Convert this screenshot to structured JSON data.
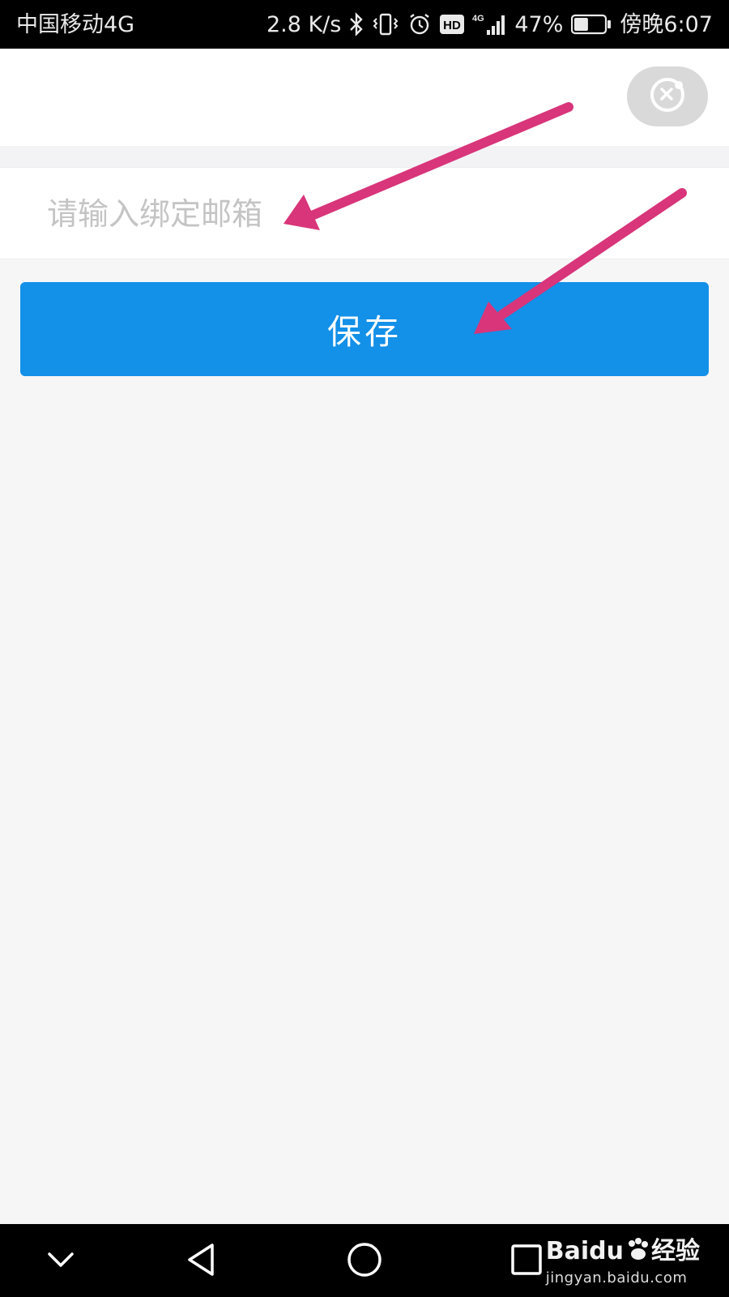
{
  "status_bar": {
    "carrier": "中国移动4G",
    "net_speed": "2.8 K/s",
    "network_label": "4G",
    "hd_label": "HD",
    "battery": "47%",
    "battery_level": 0.47,
    "time": "傍晚6:07",
    "icons": [
      "bluetooth-icon",
      "vibrate-icon",
      "alarm-icon",
      "hd-icon",
      "signal-icon",
      "battery-icon"
    ]
  },
  "top_bar": {
    "capsule_icon": "close-circle-icon"
  },
  "form": {
    "email_placeholder": "请输入绑定邮箱",
    "email_value": "",
    "save_label": "保存"
  },
  "annotations": {
    "arrow_color": "#d8357a"
  },
  "nav_bar": {
    "icons": [
      "chevron-down-icon",
      "back-triangle-icon",
      "home-circle-icon",
      "recents-square-icon"
    ]
  },
  "watermark": {
    "brand": "Baidu",
    "suffix": "经验",
    "url": "jingyan.baidu.com"
  },
  "colors": {
    "primary": "#1390e8",
    "background": "#f6f6f7",
    "placeholder": "#c4c4c4"
  }
}
